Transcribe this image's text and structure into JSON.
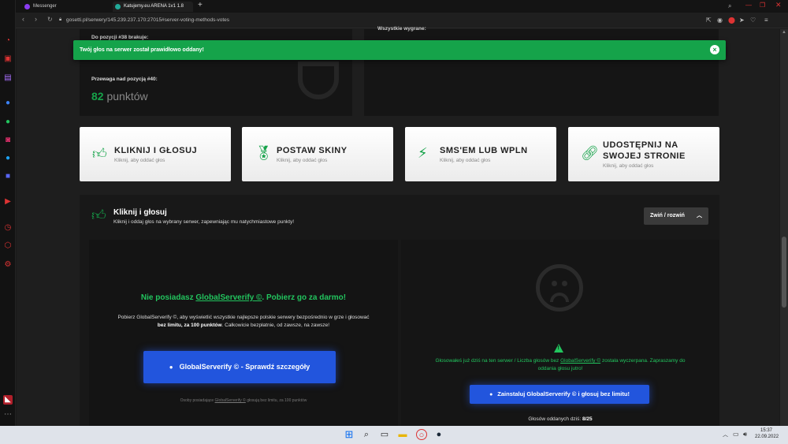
{
  "browser": {
    "tabs": [
      {
        "label": "Messenger"
      },
      {
        "label": "Katujemy.eu ARENA 1v1 1.8"
      }
    ],
    "url": "gosetti.pl/serwery/145.239.237.170:27015#server-voting-methods-votes",
    "new_tab_icon": "+"
  },
  "stats": {
    "above_label": "Do pozycji #38 brakuje:",
    "advantage_label": "Przewaga nad pozycją #40:",
    "advantage_value": "82",
    "advantage_unit": "punktów",
    "right_label": "Wszystkie wygrane:"
  },
  "toast": {
    "message": "Twój głos na serwer został prawidłowo oddany!",
    "close_icon": "×"
  },
  "methods": [
    {
      "title": "KLIKNIJ I GŁOSUJ",
      "sub": "Kliknij, aby oddać głos"
    },
    {
      "title": "POSTAW SKINY",
      "sub": "Kliknij, aby oddać głos"
    },
    {
      "title": "SMS'EM LUB WPLN",
      "sub": "Kliknij, aby oddać głos"
    },
    {
      "title": "UDOSTĘPNIJ NA",
      "title2": "SWOJEJ STRONIE",
      "sub": "Kliknij, aby oddać głos"
    }
  ],
  "section": {
    "title": "Kliknij i głosuj",
    "subtitle": "Kliknij i oddaj głos na wybrany serwer, zapewniając mu natychmiastowe punkty!",
    "toggle_label": "Zwiń / rozwiń"
  },
  "left_box": {
    "headline_pre": "Nie posiadasz ",
    "headline_link": "GlobalServerify ©",
    "headline_post": ". Pobierz go za darmo!",
    "desc_1": "Pobierz GlobalServerify ©, aby wyświetlić wszystkie najlepsze polskie serwery bezpośrednio w grze i głosować",
    "desc_bold": "bez limitu, za 100 punktów",
    "desc_2": ". Całkowicie bezpłatnie, od zawsze, na zawsze!",
    "button_label": "GlobalServerify © - Sprawdź szczegóły",
    "footnote_pre": "Osoby posiadające ",
    "footnote_link": "GlobalServerify ©",
    "footnote_post": " głosują bez limitu, za 100 punktów"
  },
  "right_box": {
    "warn_icon": "!",
    "msg_1": "Głosowałeś już dziś na ten serwer / Liczba głosów bez ",
    "msg_link": "GlobalServerify ©",
    "msg_2": " została wyczerpana. Zapraszamy do",
    "msg_3": "oddania głosu jutro!",
    "button_label": "Zainstaluj GlobalServerify © i głosuj bez limitu!",
    "votes_label": "Głosów oddanych dziś: ",
    "votes_value": "8/25"
  },
  "taskbar": {
    "time": "15:37",
    "date": "22.09.2022"
  },
  "colors": {
    "accent_green": "#16a34a",
    "button_blue": "#2255dd",
    "toast_green": "#15a34a"
  }
}
